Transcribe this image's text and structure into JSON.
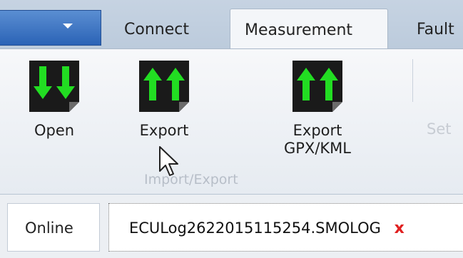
{
  "tabs": {
    "connect": "Connect",
    "measurement": "Measurement",
    "faults": "Fault"
  },
  "ribbon": {
    "open_label": "Open",
    "export_label": "Export",
    "export_gpx_line1": "Export",
    "export_gpx_line2": "GPX/KML",
    "set_label": "Set",
    "group_label": "Import/Export"
  },
  "status": {
    "online_label": "Online",
    "file_name": "ECULog2622015115254.SMOLOG",
    "close_symbol": "x"
  },
  "colors": {
    "accent": "#2b63b6",
    "icon_arrow": "#22dd22",
    "icon_bg": "#1a1a1a",
    "close": "#e02020"
  }
}
